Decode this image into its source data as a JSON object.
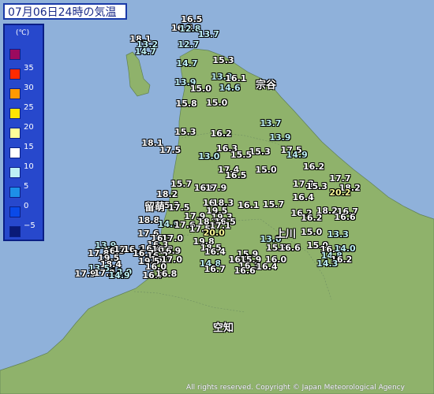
{
  "header": {
    "title": "07月06日24時の気温"
  },
  "legend": {
    "unit": "(℃)",
    "items": [
      {
        "label": "",
        "color": "#9c0a5e"
      },
      {
        "label": "35",
        "color": "#ff2a00"
      },
      {
        "label": "30",
        "color": "#ff9900"
      },
      {
        "label": "25",
        "color": "#ffe500"
      },
      {
        "label": "20",
        "color": "#fffe99"
      },
      {
        "label": "15",
        "color": "#ffffff"
      },
      {
        "label": "10",
        "color": "#bdf0f5"
      },
      {
        "label": "5",
        "color": "#1d8fe8"
      },
      {
        "label": "0",
        "color": "#0a4ae8"
      },
      {
        "label": "−5",
        "color": "#0a1a77"
      }
    ]
  },
  "cities": [
    "宗谷",
    "留萌",
    "上川",
    "空知"
  ],
  "readings": [
    {
      "value": "16.5",
      "color": "#ffffff",
      "lon": 141.685,
      "lat": 45.513
    },
    {
      "value": "16.8",
      "color": "#ffffff",
      "lon": 141.59,
      "lat": 45.443
    },
    {
      "value": "12.8",
      "color": "#bdf0f5",
      "lon": 141.669,
      "lat": 45.439
    },
    {
      "value": "13.7",
      "color": "#bdf0f5",
      "lon": 141.852,
      "lat": 45.392
    },
    {
      "value": "18.1",
      "color": "#ffffff",
      "lon": 141.182,
      "lat": 45.348
    },
    {
      "value": "13.2",
      "color": "#bdf0f5",
      "lon": 141.249,
      "lat": 45.303
    },
    {
      "value": "12.7",
      "color": "#bdf0f5",
      "lon": 141.654,
      "lat": 45.303
    },
    {
      "value": "14.7",
      "color": "#bdf0f5",
      "lon": 141.232,
      "lat": 45.245
    },
    {
      "value": "14.7",
      "color": "#bdf0f5",
      "lon": 141.639,
      "lat": 45.149
    },
    {
      "value": "15.3",
      "color": "#ffffff",
      "lon": 141.996,
      "lat": 45.176
    },
    {
      "value": "13.9",
      "color": "#bdf0f5",
      "lon": 141.98,
      "lat": 45.038
    },
    {
      "value": "16.1",
      "color": "#ffffff",
      "lon": 142.119,
      "lat": 45.025
    },
    {
      "value": "13.9",
      "color": "#bdf0f5",
      "lon": 141.623,
      "lat": 44.986
    },
    {
      "value": "15.0",
      "color": "#ffffff",
      "lon": 141.774,
      "lat": 44.939
    },
    {
      "value": "14.6",
      "color": "#bdf0f5",
      "lon": 142.059,
      "lat": 44.946
    },
    {
      "value": "15.8",
      "color": "#ffffff",
      "lon": 141.633,
      "lat": 44.813
    },
    {
      "value": "15.0",
      "color": "#ffffff",
      "lon": 141.932,
      "lat": 44.818
    },
    {
      "value": "13.7",
      "color": "#bdf0f5",
      "lon": 142.461,
      "lat": 44.646
    },
    {
      "value": "15.3",
      "color": "#ffffff",
      "lon": 141.623,
      "lat": 44.576
    },
    {
      "value": "16.2",
      "color": "#ffffff",
      "lon": 141.974,
      "lat": 44.563
    },
    {
      "value": "13.9",
      "color": "#bdf0f5",
      "lon": 142.554,
      "lat": 44.528
    },
    {
      "value": "18.1",
      "color": "#ffffff",
      "lon": 141.298,
      "lat": 44.485
    },
    {
      "value": "17.5",
      "color": "#ffffff",
      "lon": 141.475,
      "lat": 44.426
    },
    {
      "value": "16.3",
      "color": "#ffffff",
      "lon": 142.032,
      "lat": 44.436
    },
    {
      "value": "15.3",
      "color": "#ffffff",
      "lon": 142.354,
      "lat": 44.41
    },
    {
      "value": "17.5",
      "color": "#ffffff",
      "lon": 142.664,
      "lat": 44.426
    },
    {
      "value": "15.5",
      "color": "#ffffff",
      "lon": 142.171,
      "lat": 44.384
    },
    {
      "value": "14.9",
      "color": "#bdf0f5",
      "lon": 142.719,
      "lat": 44.384
    },
    {
      "value": "13.0",
      "color": "#bdf0f5",
      "lon": 141.855,
      "lat": 44.368
    },
    {
      "value": "16.2",
      "color": "#ffffff",
      "lon": 142.884,
      "lat": 44.282
    },
    {
      "value": "17.4",
      "color": "#ffffff",
      "lon": 142.047,
      "lat": 44.256
    },
    {
      "value": "15.0",
      "color": "#ffffff",
      "lon": 142.415,
      "lat": 44.256
    },
    {
      "value": "16.5",
      "color": "#ffffff",
      "lon": 142.119,
      "lat": 44.21
    },
    {
      "value": "17.7",
      "color": "#ffffff",
      "lon": 143.143,
      "lat": 44.184
    },
    {
      "value": "15.7",
      "color": "#ffffff",
      "lon": 141.583,
      "lat": 44.138
    },
    {
      "value": "17.2",
      "color": "#ffffff",
      "lon": 142.784,
      "lat": 44.138
    },
    {
      "value": "15.3",
      "color": "#ffffff",
      "lon": 142.914,
      "lat": 44.118
    },
    {
      "value": "16.8",
      "color": "#ffffff",
      "lon": 141.813,
      "lat": 44.105
    },
    {
      "value": "17.9",
      "color": "#ffffff",
      "lon": 141.924,
      "lat": 44.105
    },
    {
      "value": "18.2",
      "color": "#ffffff",
      "lon": 143.238,
      "lat": 44.105
    },
    {
      "value": "20.2",
      "color": "#fffe99",
      "lon": 143.143,
      "lat": 44.066
    },
    {
      "value": "18.2",
      "color": "#ffffff",
      "lon": 141.444,
      "lat": 44.053
    },
    {
      "value": "16.4",
      "color": "#ffffff",
      "lon": 142.781,
      "lat": 44.027
    },
    {
      "value": "16.3",
      "color": "#ffffff",
      "lon": 141.9,
      "lat": 43.981
    },
    {
      "value": "18.3",
      "color": "#ffffff",
      "lon": 141.993,
      "lat": 43.981
    },
    {
      "value": "16.6",
      "color": "#ffffff",
      "lon": 141.325,
      "lat": 43.962
    },
    {
      "value": "15.3",
      "color": "#ffffff",
      "lon": 141.459,
      "lat": 43.962
    },
    {
      "value": "16.1",
      "color": "#ffffff",
      "lon": 142.243,
      "lat": 43.962
    },
    {
      "value": "15.7",
      "color": "#ffffff",
      "lon": 142.489,
      "lat": 43.968
    },
    {
      "value": "17.5",
      "color": "#ffffff",
      "lon": 141.561,
      "lat": 43.942
    },
    {
      "value": "19.5",
      "color": "#ffffff",
      "lon": 141.932,
      "lat": 43.916
    },
    {
      "value": "18.2",
      "color": "#ffffff",
      "lon": 143.014,
      "lat": 43.916
    },
    {
      "value": "16.7",
      "color": "#ffffff",
      "lon": 143.216,
      "lat": 43.91
    },
    {
      "value": "16.2",
      "color": "#ffffff",
      "lon": 142.764,
      "lat": 43.897
    },
    {
      "value": "17.9",
      "color": "#ffffff",
      "lon": 141.716,
      "lat": 43.871
    },
    {
      "value": "19.3",
      "color": "#ffffff",
      "lon": 141.981,
      "lat": 43.864
    },
    {
      "value": "16.6",
      "color": "#ffffff",
      "lon": 143.191,
      "lat": 43.864
    },
    {
      "value": "16.2",
      "color": "#ffffff",
      "lon": 142.863,
      "lat": 43.858
    },
    {
      "value": "18.8",
      "color": "#ffffff",
      "lon": 141.264,
      "lat": 43.838
    },
    {
      "value": "18.1",
      "color": "#ffffff",
      "lon": 141.848,
      "lat": 43.825
    },
    {
      "value": "16.5",
      "color": "#ffffff",
      "lon": 142.013,
      "lat": 43.825
    },
    {
      "value": "14.9",
      "color": "#bdf0f5",
      "lon": 141.457,
      "lat": 43.805
    },
    {
      "value": "17.6",
      "color": "#ffffff",
      "lon": 141.616,
      "lat": 43.799
    },
    {
      "value": "17.1",
      "color": "#ffffff",
      "lon": 141.965,
      "lat": 43.792
    },
    {
      "value": "17.5",
      "color": "#ffffff",
      "lon": 141.766,
      "lat": 43.766
    },
    {
      "value": "15.0",
      "color": "#ffffff",
      "lon": 142.862,
      "lat": 43.74
    },
    {
      "value": "20.0",
      "color": "#fffe99",
      "lon": 141.905,
      "lat": 43.734
    },
    {
      "value": "17.6",
      "color": "#ffffff",
      "lon": 141.259,
      "lat": 43.727
    },
    {
      "value": "13.3",
      "color": "#bdf0f5",
      "lon": 143.123,
      "lat": 43.721
    },
    {
      "value": "16.3",
      "color": "#ffffff",
      "lon": 141.39,
      "lat": 43.688
    },
    {
      "value": "17.0",
      "color": "#ffffff",
      "lon": 141.496,
      "lat": 43.688
    },
    {
      "value": "13.0",
      "color": "#bdf0f5",
      "lon": 142.462,
      "lat": 43.682
    },
    {
      "value": "19.8",
      "color": "#ffffff",
      "lon": 141.803,
      "lat": 43.662
    },
    {
      "value": "16.3",
      "color": "#ffffff",
      "lon": 141.351,
      "lat": 43.636
    },
    {
      "value": "13.9",
      "color": "#bdf0f5",
      "lon": 140.84,
      "lat": 43.629
    },
    {
      "value": "18.5",
      "color": "#ffffff",
      "lon": 141.874,
      "lat": 43.61
    },
    {
      "value": "15.9",
      "color": "#ffffff",
      "lon": 142.52,
      "lat": 43.61
    },
    {
      "value": "16.6",
      "color": "#ffffff",
      "lon": 142.649,
      "lat": 43.61
    },
    {
      "value": "15.0",
      "color": "#ffffff",
      "lon": 142.922,
      "lat": 43.629
    },
    {
      "value": "16.0",
      "color": "#ffffff",
      "lon": 143.053,
      "lat": 43.597
    },
    {
      "value": "14.0",
      "color": "#bdf0f5",
      "lon": 143.191,
      "lat": 43.603
    },
    {
      "value": "16.3",
      "color": "#ffffff",
      "lon": 140.924,
      "lat": 43.584
    },
    {
      "value": "17.2",
      "color": "#ffffff",
      "lon": 141.025,
      "lat": 43.597
    },
    {
      "value": "16.2",
      "color": "#ffffff",
      "lon": 141.118,
      "lat": 43.597
    },
    {
      "value": "16.4",
      "color": "#ffffff",
      "lon": 141.284,
      "lat": 43.603
    },
    {
      "value": "16.2",
      "color": "#ffffff",
      "lon": 141.398,
      "lat": 43.597
    },
    {
      "value": "16.9",
      "color": "#ffffff",
      "lon": 141.475,
      "lat": 43.584
    },
    {
      "value": "16.7",
      "color": "#ffffff",
      "lon": 141.211,
      "lat": 43.564
    },
    {
      "value": "16.4",
      "color": "#ffffff",
      "lon": 141.914,
      "lat": 43.577
    },
    {
      "value": "17.8",
      "color": "#ffffff",
      "lon": 140.77,
      "lat": 43.564
    },
    {
      "value": "15.9",
      "color": "#ffffff",
      "lon": 142.234,
      "lat": 43.558
    },
    {
      "value": "16.2",
      "color": "#ffffff",
      "lon": 141.35,
      "lat": 43.545
    },
    {
      "value": "14.8",
      "color": "#bdf0f5",
      "lon": 143.061,
      "lat": 43.545
    },
    {
      "value": "19.5",
      "color": "#ffffff",
      "lon": 140.87,
      "lat": 43.519
    },
    {
      "value": "16.1",
      "color": "#ffffff",
      "lon": 141.385,
      "lat": 43.506
    },
    {
      "value": "17.0",
      "color": "#ffffff",
      "lon": 141.488,
      "lat": 43.506
    },
    {
      "value": "19.5",
      "color": "#ffffff",
      "lon": 141.266,
      "lat": 43.499
    },
    {
      "value": "16.3",
      "color": "#ffffff",
      "lon": 142.154,
      "lat": 43.512
    },
    {
      "value": "15.9",
      "color": "#ffffff",
      "lon": 142.266,
      "lat": 43.506
    },
    {
      "value": "16.0",
      "color": "#ffffff",
      "lon": 142.512,
      "lat": 43.512
    },
    {
      "value": "16.2",
      "color": "#ffffff",
      "lon": 143.157,
      "lat": 43.512
    },
    {
      "value": "14.8",
      "color": "#bdf0f5",
      "lon": 141.868,
      "lat": 43.473
    },
    {
      "value": "14.3",
      "color": "#bdf0f5",
      "lon": 143.018,
      "lat": 43.473
    },
    {
      "value": "18.4",
      "color": "#ffffff",
      "lon": 140.891,
      "lat": 43.467
    },
    {
      "value": "16.0",
      "color": "#ffffff",
      "lon": 141.333,
      "lat": 43.447
    },
    {
      "value": "16.3",
      "color": "#ffffff",
      "lon": 142.25,
      "lat": 43.454
    },
    {
      "value": "16.4",
      "color": "#ffffff",
      "lon": 142.422,
      "lat": 43.447
    },
    {
      "value": "13.5",
      "color": "#bdf0f5",
      "lon": 140.776,
      "lat": 43.434
    },
    {
      "value": "16.7",
      "color": "#ffffff",
      "lon": 141.912,
      "lat": 43.428
    },
    {
      "value": "16.6",
      "color": "#ffffff",
      "lon": 142.207,
      "lat": 43.415
    },
    {
      "value": "13.9",
      "color": "#bdf0f5",
      "lon": 140.994,
      "lat": 43.402
    },
    {
      "value": "17.9",
      "color": "#ffffff",
      "lon": 140.641,
      "lat": 43.389
    },
    {
      "value": "17.2",
      "color": "#ffffff",
      "lon": 140.828,
      "lat": 43.396
    },
    {
      "value": "14.9",
      "color": "#bdf0f5",
      "lon": 140.974,
      "lat": 43.376
    },
    {
      "value": "16.7",
      "color": "#ffffff",
      "lon": 141.307,
      "lat": 43.376
    },
    {
      "value": "16.8",
      "color": "#ffffff",
      "lon": 141.436,
      "lat": 43.389
    }
  ],
  "footer": {
    "copyright": "All rights reserved. Copyright © Japan Meteorological Agency"
  }
}
